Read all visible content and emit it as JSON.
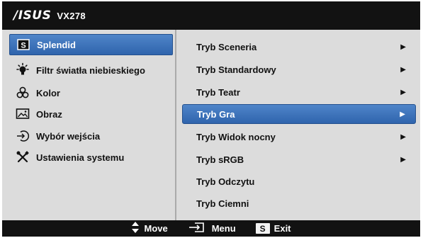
{
  "header": {
    "brand": "/ISUS",
    "model": "VX278"
  },
  "main_menu": [
    {
      "label": "Splendid",
      "icon": "s-box-icon",
      "selected": true
    },
    {
      "label": "Filtr światła niebieskiego",
      "icon": "bulb-icon",
      "selected": false
    },
    {
      "label": "Kolor",
      "icon": "color-circles-icon",
      "selected": false
    },
    {
      "label": "Obraz",
      "icon": "image-icon",
      "selected": false
    },
    {
      "label": "Wybór wejścia",
      "icon": "input-arrow-icon",
      "selected": false
    },
    {
      "label": "Ustawienia systemu",
      "icon": "tools-icon",
      "selected": false
    }
  ],
  "submenu": [
    {
      "label": "Tryb Sceneria",
      "has_arrow": true,
      "selected": false
    },
    {
      "label": "Tryb Standardowy",
      "has_arrow": true,
      "selected": false
    },
    {
      "label": "Tryb Teatr",
      "has_arrow": true,
      "selected": false
    },
    {
      "label": "Tryb Gra",
      "has_arrow": true,
      "selected": true
    },
    {
      "label": "Tryb Widok nocny",
      "has_arrow": true,
      "selected": false
    },
    {
      "label": "Tryb sRGB",
      "has_arrow": true,
      "selected": false
    },
    {
      "label": "Tryb Odczytu",
      "has_arrow": false,
      "selected": false
    },
    {
      "label": "Tryb Ciemni",
      "has_arrow": false,
      "selected": false
    }
  ],
  "footer": {
    "move_label": "Move",
    "menu_label": "Menu",
    "exit_label": "Exit",
    "s_key": "S"
  },
  "colors": {
    "selection": "#3a6fb8",
    "panel": "#dcdcdc",
    "bar": "#121212"
  }
}
